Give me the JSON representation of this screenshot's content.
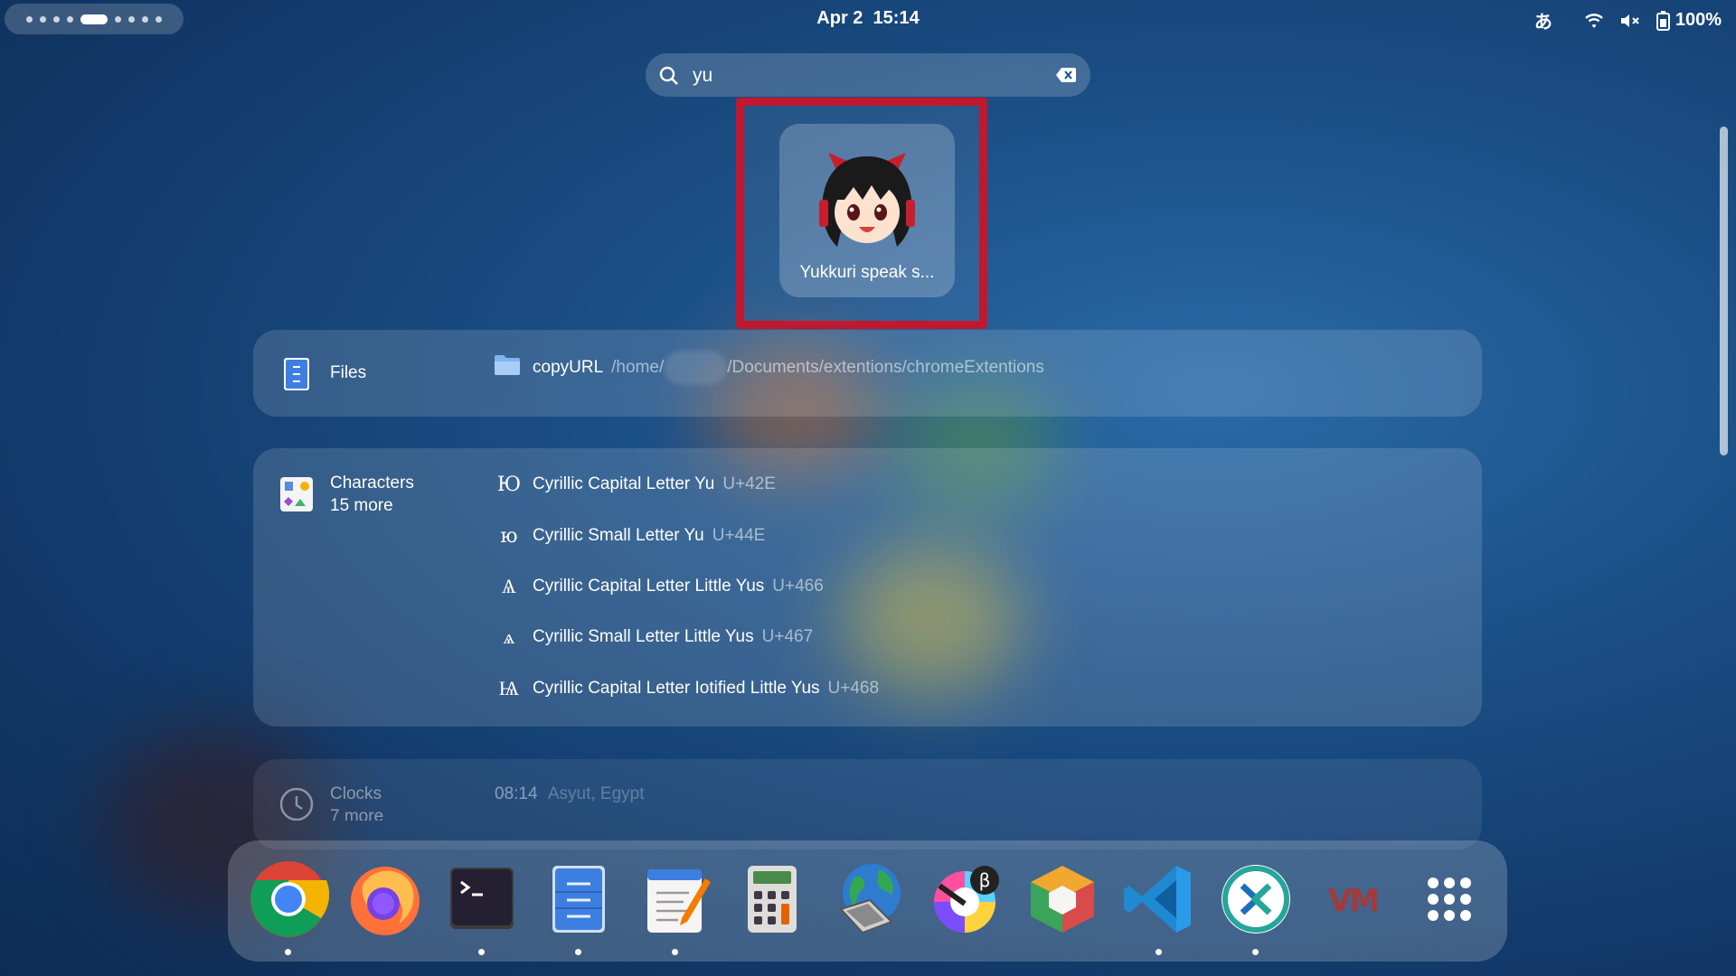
{
  "topbar": {
    "date": "Apr 2",
    "time": "15:14",
    "input_method": "あ",
    "battery": "100%"
  },
  "search": {
    "query": "yu"
  },
  "app_result": {
    "label": "Yukkuri speak s..."
  },
  "files": {
    "provider": "Files",
    "items": [
      {
        "name": "copyURL",
        "path_prefix": "/home/",
        "path_suffix": "/Documents/extentions/chromeExtentions"
      }
    ]
  },
  "characters": {
    "provider": "Characters",
    "more": "15 more",
    "items": [
      {
        "glyph": "Ю",
        "name": "Cyrillic Capital Letter Yu",
        "code": "U+42E"
      },
      {
        "glyph": "ю",
        "name": "Cyrillic Small Letter Yu",
        "code": "U+44E"
      },
      {
        "glyph": "Ѧ",
        "name": "Cyrillic Capital Letter Little Yus",
        "code": "U+466"
      },
      {
        "glyph": "ѧ",
        "name": "Cyrillic Small Letter Little Yus",
        "code": "U+467"
      },
      {
        "glyph": "Ѩ",
        "name": "Cyrillic Capital Letter Iotified Little Yus",
        "code": "U+468"
      }
    ]
  },
  "clocks": {
    "provider": "Clocks",
    "more": "7 more",
    "items": [
      {
        "time": "08:14",
        "place": "Asyut, Egypt"
      }
    ]
  },
  "dock": {
    "apps": [
      {
        "icon": "chrome-icon",
        "running": true
      },
      {
        "icon": "firefox-icon",
        "running": false
      },
      {
        "icon": "terminal-icon",
        "running": true
      },
      {
        "icon": "files-icon",
        "running": true
      },
      {
        "icon": "text-editor-icon",
        "running": true
      },
      {
        "icon": "calculator-icon",
        "running": false
      },
      {
        "icon": "network-laptop-icon",
        "running": false
      },
      {
        "icon": "color-picker-beta-icon",
        "running": false
      },
      {
        "icon": "cube-app-icon",
        "running": false
      },
      {
        "icon": "vscode-icon",
        "running": true
      },
      {
        "icon": "remote-desktop-icon",
        "running": true
      },
      {
        "icon": "vm-icon",
        "running": false
      },
      {
        "icon": "app-grid-icon",
        "running": false
      }
    ],
    "vm_label": "VM"
  },
  "colors": {
    "highlight": "#c0182e",
    "background": "#1b4f86"
  }
}
